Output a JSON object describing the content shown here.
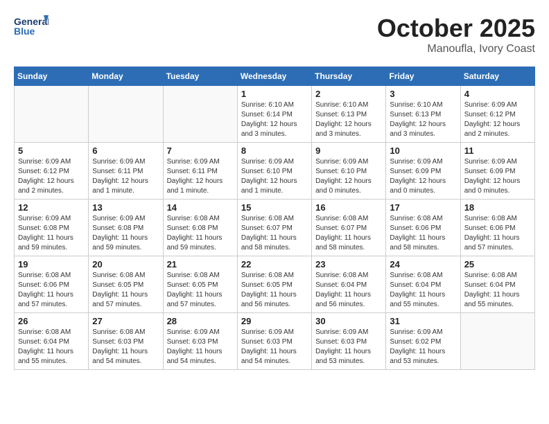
{
  "header": {
    "logo_line1": "General",
    "logo_line2": "Blue",
    "month": "October 2025",
    "location": "Manoufla, Ivory Coast"
  },
  "weekdays": [
    "Sunday",
    "Monday",
    "Tuesday",
    "Wednesday",
    "Thursday",
    "Friday",
    "Saturday"
  ],
  "weeks": [
    [
      {
        "day": "",
        "info": ""
      },
      {
        "day": "",
        "info": ""
      },
      {
        "day": "",
        "info": ""
      },
      {
        "day": "1",
        "info": "Sunrise: 6:10 AM\nSunset: 6:14 PM\nDaylight: 12 hours\nand 3 minutes."
      },
      {
        "day": "2",
        "info": "Sunrise: 6:10 AM\nSunset: 6:13 PM\nDaylight: 12 hours\nand 3 minutes."
      },
      {
        "day": "3",
        "info": "Sunrise: 6:10 AM\nSunset: 6:13 PM\nDaylight: 12 hours\nand 3 minutes."
      },
      {
        "day": "4",
        "info": "Sunrise: 6:09 AM\nSunset: 6:12 PM\nDaylight: 12 hours\nand 2 minutes."
      }
    ],
    [
      {
        "day": "5",
        "info": "Sunrise: 6:09 AM\nSunset: 6:12 PM\nDaylight: 12 hours\nand 2 minutes."
      },
      {
        "day": "6",
        "info": "Sunrise: 6:09 AM\nSunset: 6:11 PM\nDaylight: 12 hours\nand 1 minute."
      },
      {
        "day": "7",
        "info": "Sunrise: 6:09 AM\nSunset: 6:11 PM\nDaylight: 12 hours\nand 1 minute."
      },
      {
        "day": "8",
        "info": "Sunrise: 6:09 AM\nSunset: 6:10 PM\nDaylight: 12 hours\nand 1 minute."
      },
      {
        "day": "9",
        "info": "Sunrise: 6:09 AM\nSunset: 6:10 PM\nDaylight: 12 hours\nand 0 minutes."
      },
      {
        "day": "10",
        "info": "Sunrise: 6:09 AM\nSunset: 6:09 PM\nDaylight: 12 hours\nand 0 minutes."
      },
      {
        "day": "11",
        "info": "Sunrise: 6:09 AM\nSunset: 6:09 PM\nDaylight: 12 hours\nand 0 minutes."
      }
    ],
    [
      {
        "day": "12",
        "info": "Sunrise: 6:09 AM\nSunset: 6:08 PM\nDaylight: 11 hours\nand 59 minutes."
      },
      {
        "day": "13",
        "info": "Sunrise: 6:09 AM\nSunset: 6:08 PM\nDaylight: 11 hours\nand 59 minutes."
      },
      {
        "day": "14",
        "info": "Sunrise: 6:08 AM\nSunset: 6:08 PM\nDaylight: 11 hours\nand 59 minutes."
      },
      {
        "day": "15",
        "info": "Sunrise: 6:08 AM\nSunset: 6:07 PM\nDaylight: 11 hours\nand 58 minutes."
      },
      {
        "day": "16",
        "info": "Sunrise: 6:08 AM\nSunset: 6:07 PM\nDaylight: 11 hours\nand 58 minutes."
      },
      {
        "day": "17",
        "info": "Sunrise: 6:08 AM\nSunset: 6:06 PM\nDaylight: 11 hours\nand 58 minutes."
      },
      {
        "day": "18",
        "info": "Sunrise: 6:08 AM\nSunset: 6:06 PM\nDaylight: 11 hours\nand 57 minutes."
      }
    ],
    [
      {
        "day": "19",
        "info": "Sunrise: 6:08 AM\nSunset: 6:06 PM\nDaylight: 11 hours\nand 57 minutes."
      },
      {
        "day": "20",
        "info": "Sunrise: 6:08 AM\nSunset: 6:05 PM\nDaylight: 11 hours\nand 57 minutes."
      },
      {
        "day": "21",
        "info": "Sunrise: 6:08 AM\nSunset: 6:05 PM\nDaylight: 11 hours\nand 57 minutes."
      },
      {
        "day": "22",
        "info": "Sunrise: 6:08 AM\nSunset: 6:05 PM\nDaylight: 11 hours\nand 56 minutes."
      },
      {
        "day": "23",
        "info": "Sunrise: 6:08 AM\nSunset: 6:04 PM\nDaylight: 11 hours\nand 56 minutes."
      },
      {
        "day": "24",
        "info": "Sunrise: 6:08 AM\nSunset: 6:04 PM\nDaylight: 11 hours\nand 55 minutes."
      },
      {
        "day": "25",
        "info": "Sunrise: 6:08 AM\nSunset: 6:04 PM\nDaylight: 11 hours\nand 55 minutes."
      }
    ],
    [
      {
        "day": "26",
        "info": "Sunrise: 6:08 AM\nSunset: 6:04 PM\nDaylight: 11 hours\nand 55 minutes."
      },
      {
        "day": "27",
        "info": "Sunrise: 6:08 AM\nSunset: 6:03 PM\nDaylight: 11 hours\nand 54 minutes."
      },
      {
        "day": "28",
        "info": "Sunrise: 6:09 AM\nSunset: 6:03 PM\nDaylight: 11 hours\nand 54 minutes."
      },
      {
        "day": "29",
        "info": "Sunrise: 6:09 AM\nSunset: 6:03 PM\nDaylight: 11 hours\nand 54 minutes."
      },
      {
        "day": "30",
        "info": "Sunrise: 6:09 AM\nSunset: 6:03 PM\nDaylight: 11 hours\nand 53 minutes."
      },
      {
        "day": "31",
        "info": "Sunrise: 6:09 AM\nSunset: 6:02 PM\nDaylight: 11 hours\nand 53 minutes."
      },
      {
        "day": "",
        "info": ""
      }
    ]
  ]
}
